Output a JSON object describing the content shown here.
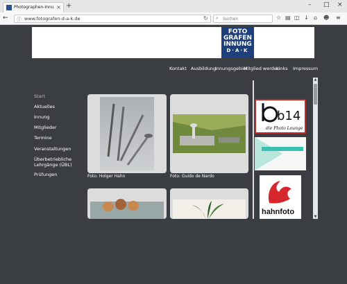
{
  "browser": {
    "tab_title": "Photographen-Innung Du...",
    "new_tab": "+",
    "url": "www.fotografen-d-a-k.de",
    "search_placeholder": "Suchen"
  },
  "header": {
    "logo_line1": "FOTO",
    "logo_line2": "GRAFEN",
    "logo_line3": "INNUNG",
    "logo_line4": "D·A·K"
  },
  "topnav": [
    "Kontakt",
    "Ausbildung",
    "Innungsgebiet",
    "Mitglied werden",
    "Links",
    "Impressum"
  ],
  "sidenav": [
    "Start",
    "Aktuelles",
    "Innung",
    "Mitglieder",
    "Termine",
    "Veranstaltungen",
    "Überbetriebliche",
    "Lehrgänge (ÜBL)",
    "Prüfungen"
  ],
  "gallery": {
    "caption1": "Foto: Holger Hahn",
    "caption2": "Foto: Guido de Nardo"
  },
  "sponsors": {
    "b14_big": "b14",
    "b14_sub": "die Photo Lounge",
    "hahn": "hahnfoto"
  },
  "colors": {
    "page_bg": "#3a3d42",
    "logo_blue": "#1d3f7a",
    "hahn_red": "#d6262e"
  }
}
